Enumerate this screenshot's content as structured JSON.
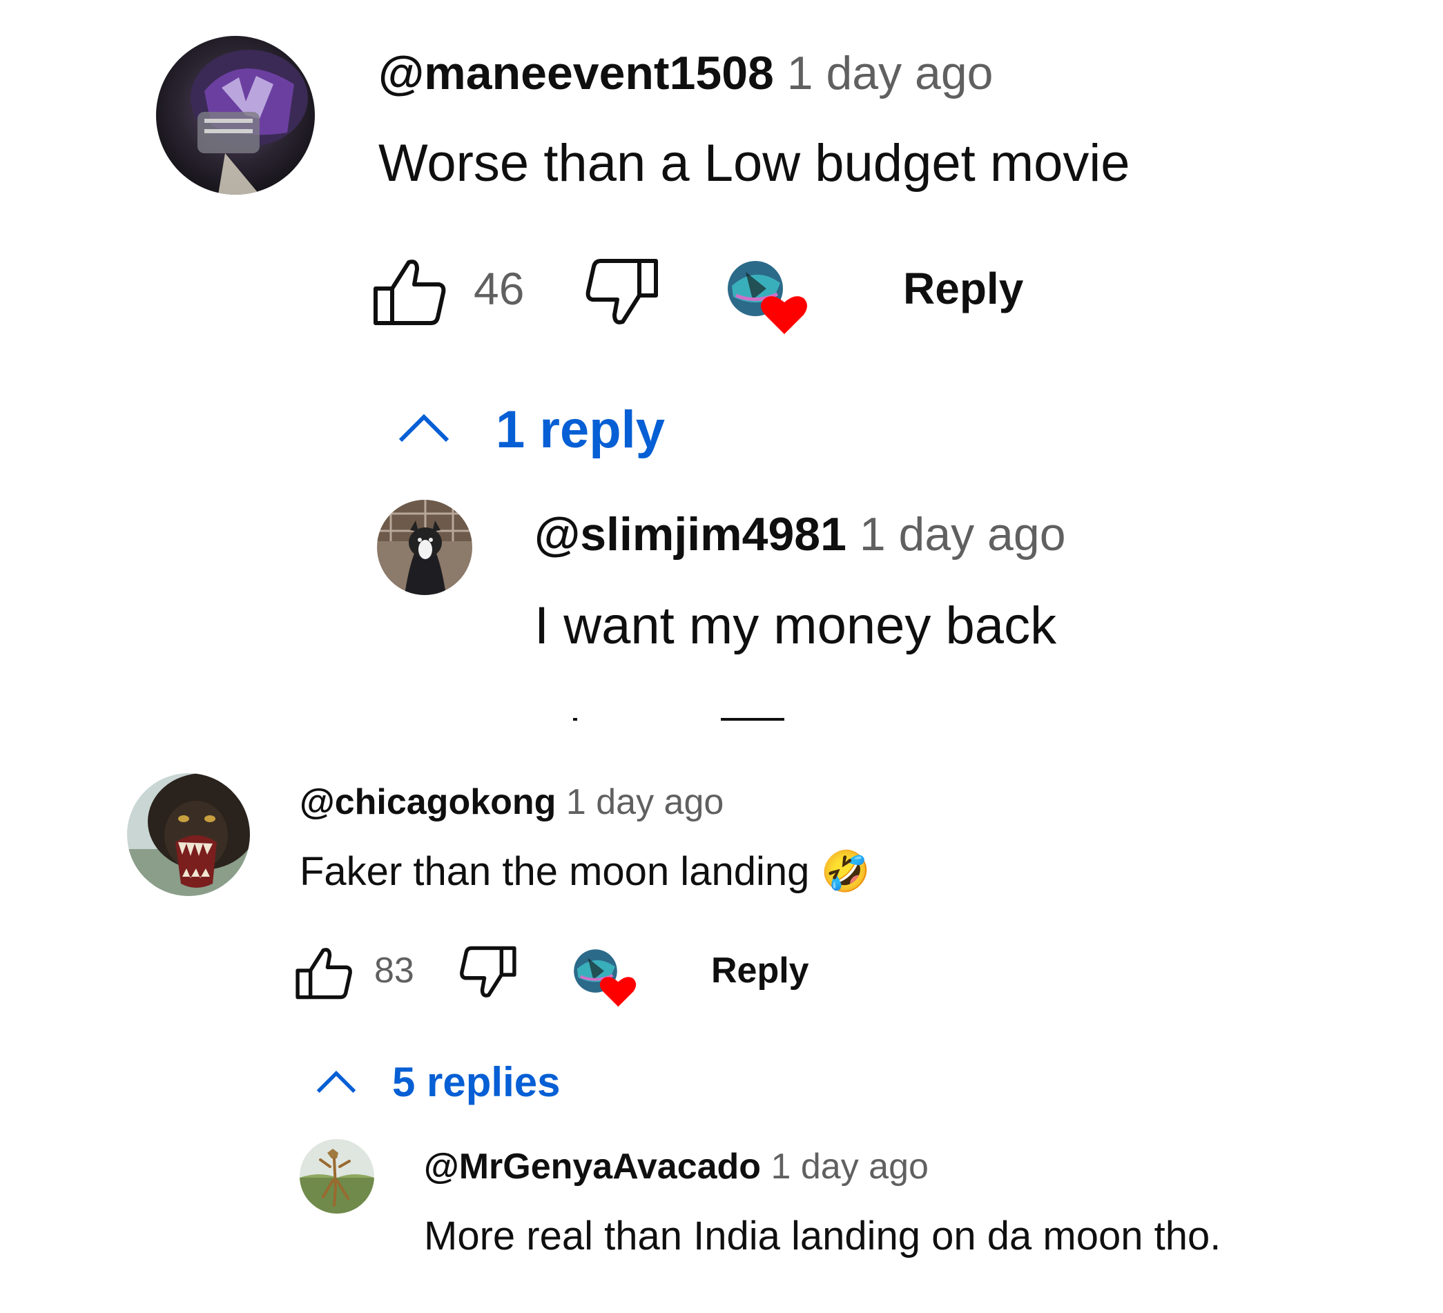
{
  "comments": [
    {
      "handle": "@maneevent1508",
      "time": "1 day ago",
      "text": "Worse than a Low budget movie",
      "likes": "46",
      "reply_label": "Reply",
      "replies_toggle": "1 reply",
      "avatar_icon": "helmet-avatar",
      "reply": {
        "handle": "@slimjim4981",
        "time": "1 day ago",
        "text": "I want my money back",
        "avatar_icon": "dog-avatar"
      }
    },
    {
      "handle": "@chicagokong",
      "time": "1 day ago",
      "text": "Faker than the moon landing",
      "emoji": "🤣",
      "likes": "83",
      "reply_label": "Reply",
      "replies_toggle": "5 replies",
      "avatar_icon": "gorilla-avatar",
      "reply": {
        "handle": "@MrGenyaAvacado",
        "time": "1 day ago",
        "text": "More real than India landing on da moon tho.",
        "avatar_icon": "mantis-avatar"
      }
    }
  ],
  "colors": {
    "link_blue": "#065fd4",
    "heart_red": "#ff0000",
    "secondary_text": "#606060"
  }
}
